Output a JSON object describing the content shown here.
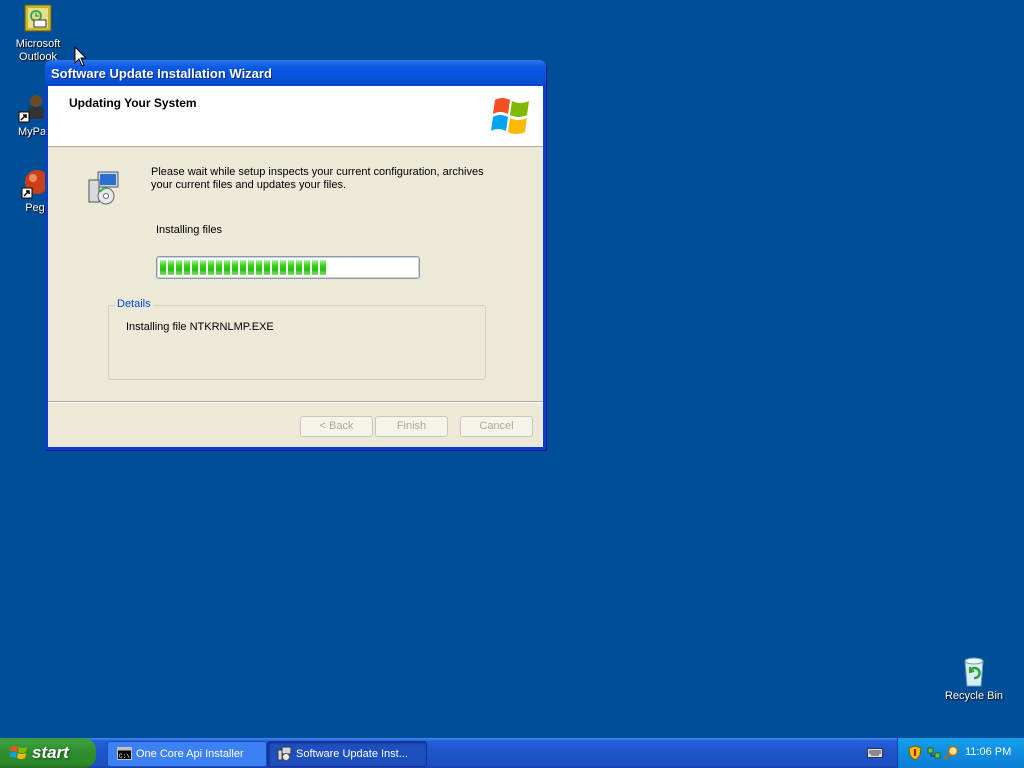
{
  "desktop": {
    "icons": [
      {
        "label": "Microsoft Outlook"
      },
      {
        "label": "MyPa"
      },
      {
        "label": "Peg"
      },
      {
        "label": "Recycle Bin"
      }
    ]
  },
  "dialog": {
    "title": "Software Update Installation Wizard",
    "header": "Updating Your System",
    "description": "Please wait while setup inspects your current configuration, archives your current files and updates your files.",
    "status": "Installing files",
    "progress_fraction": 0.68,
    "details_legend": "Details",
    "details_text": "Installing file NTKRNLMP.EXE",
    "buttons": {
      "back": "< Back",
      "finish": "Finish",
      "cancel": "Cancel"
    }
  },
  "taskbar": {
    "start_label": "start",
    "tasks": [
      {
        "label": "One Core Api Installer",
        "icon": "console-icon"
      },
      {
        "label": "Software Update Inst...",
        "icon": "setup-icon"
      }
    ],
    "clock": "11:06 PM"
  }
}
